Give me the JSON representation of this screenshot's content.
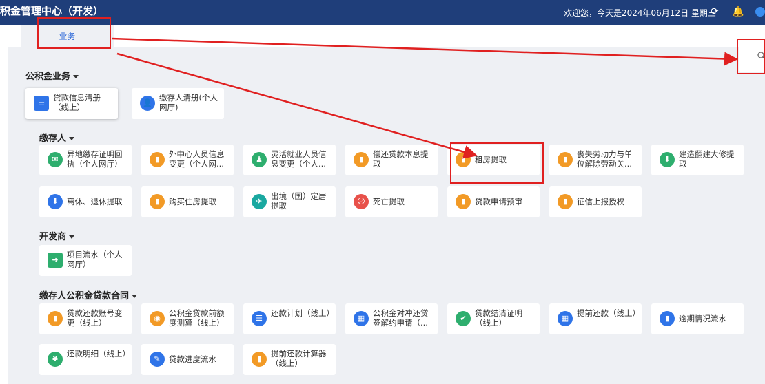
{
  "header": {
    "title": "积金管理中心（开发）",
    "greeting": "欢迎您，今天是2024年06月12日 星期三"
  },
  "tabs": [
    {
      "label": "业务"
    }
  ],
  "sections": {
    "gjj": {
      "title": "公积金业务",
      "items": [
        {
          "label": "贷款信息清册（线上）"
        },
        {
          "label": "缴存人清册(个人网厅)"
        }
      ]
    },
    "jcr": {
      "title": "缴存人",
      "items": [
        {
          "label": "异地缴存证明回执（个人网厅）"
        },
        {
          "label": "外中心人员信息变更（个人网..."
        },
        {
          "label": "灵活就业人员信息变更（个人..."
        },
        {
          "label": "偿还贷款本息提取"
        },
        {
          "label": "租房提取"
        },
        {
          "label": "丧失劳动力与单位解除劳动关..."
        },
        {
          "label": "建造翻建大修提取"
        },
        {
          "label": "离休、退休提取"
        },
        {
          "label": "购买住房提取"
        },
        {
          "label": "出境（国）定居提取"
        },
        {
          "label": "死亡提取"
        },
        {
          "label": "贷款申请预审"
        },
        {
          "label": "征信上报授权"
        }
      ]
    },
    "kfs": {
      "title": "开发商",
      "items": [
        {
          "label": "项目流水（个人网厅）"
        }
      ]
    },
    "contract": {
      "title": "缴存人公积金贷款合同",
      "items": [
        {
          "label": "贷款还款账号变更（线上）"
        },
        {
          "label": "公积金贷款前额度测算（线上）"
        },
        {
          "label": "还款计划（线上）"
        },
        {
          "label": "公积金对冲还贷签解约申请（..."
        },
        {
          "label": "贷款结清证明（线上）"
        },
        {
          "label": "提前还款（线上）"
        },
        {
          "label": "逾期情况流水"
        },
        {
          "label": "还款明细（线上）"
        },
        {
          "label": "贷款进度流水"
        },
        {
          "label": "提前还款计算器（线上）"
        }
      ]
    }
  },
  "colors": {
    "header_bg": "#1f3e7a",
    "accent": "#2a66d8",
    "annotation": "#e02020"
  }
}
